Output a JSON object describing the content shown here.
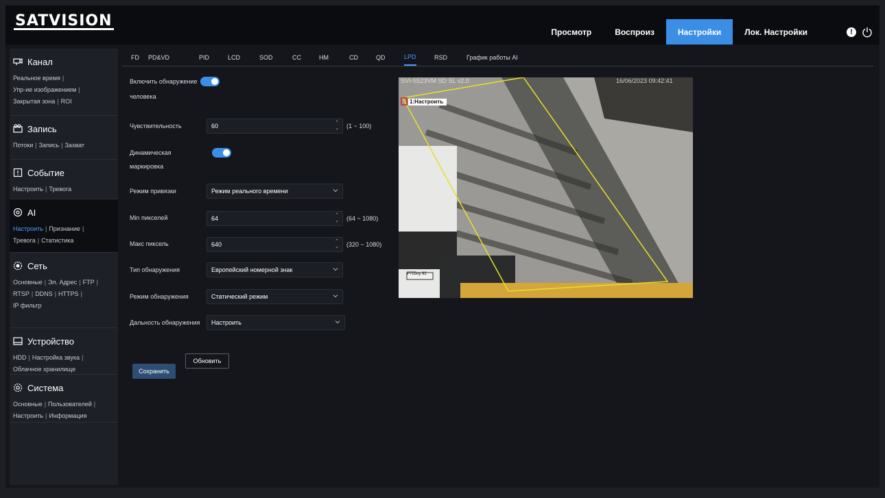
{
  "header": {
    "logo": "SATVISION",
    "nav": [
      "Просмотр",
      "Воспроиз",
      "Настройки",
      "Лок. Настройки"
    ],
    "active_nav": "Настройки",
    "alert_icon": "!",
    "power_icon": "power-icon"
  },
  "sidebar": {
    "sections": [
      {
        "title": "Канал",
        "icon": "camera-icon",
        "lines": [
          [
            "Реальное время"
          ],
          [
            "Упр-ие изображением"
          ],
          [
            "Закрытая зона",
            "ROI"
          ]
        ]
      },
      {
        "title": "Запись",
        "icon": "record-icon",
        "lines": [
          [
            "Потоки",
            "Запись",
            "Захват"
          ]
        ]
      },
      {
        "title": "Событие",
        "icon": "event-icon",
        "lines": [
          [
            "Настроить",
            "Тревога"
          ]
        ]
      },
      {
        "title": "AI",
        "icon": "ai-icon",
        "lines": [
          [
            "Настроить",
            "Признание"
          ],
          [
            "Тревога",
            "Статистика"
          ]
        ],
        "active": true,
        "active_link": "Настроить"
      },
      {
        "title": "Сеть",
        "icon": "network-icon",
        "lines": [
          [
            "Основные",
            "Эл. Адрес",
            "FTP"
          ],
          [
            "RTSP",
            "DDNS",
            "HTTPS"
          ],
          [
            "IP фильтр"
          ]
        ]
      },
      {
        "title": "Устройство",
        "icon": "device-icon",
        "lines": [
          [
            "HDD",
            "Настройка звука"
          ],
          [
            "Облачное хранилище"
          ]
        ]
      },
      {
        "title": "Система",
        "icon": "system-icon",
        "lines": [
          [
            "Основные",
            "Пользователей"
          ],
          [
            "Настроить",
            "Информация"
          ]
        ]
      }
    ]
  },
  "tabs": [
    "FD",
    "PD&VD",
    "PID",
    "LCD",
    "SOD",
    "CC",
    "HM",
    "CD",
    "QD",
    "LPD",
    "RSD",
    "График работы AI"
  ],
  "active_tab": "LPD",
  "form": {
    "enable_label": "Включить обнаружение",
    "enable_label2": "человека",
    "sensitivity_label": "Чувствительность",
    "sensitivity_value": "60",
    "sensitivity_range": "(1 ~ 100)",
    "dynamic_label": "Динамическая",
    "dynamic_label2": "маркировка",
    "snap_label": "Режим привязки",
    "snap_value": "Режим реального времени",
    "min_label": "Min пикселей",
    "min_value": "64",
    "min_range": "(64 ~ 1080)",
    "max_label": "Макс пиксель",
    "max_value": "640",
    "max_range": "(320 ~ 1080)",
    "type_label": "Тип обнаружения",
    "type_value": "Европейский номерной знак",
    "mode_label": "Режим обнаружения",
    "mode_value": "Статический режим",
    "distance_label": "Дальность обнаружения",
    "distance_value": "Настроить",
    "save_label": "Сохранить",
    "refresh_label": "Обновить"
  },
  "video": {
    "osd_name": "SVI-S523VM SD SL v2.0",
    "osd_time": "16/06/2023 09:42:41",
    "region_label": "1:Настроить",
    "plate_text": "P755oy 92"
  }
}
